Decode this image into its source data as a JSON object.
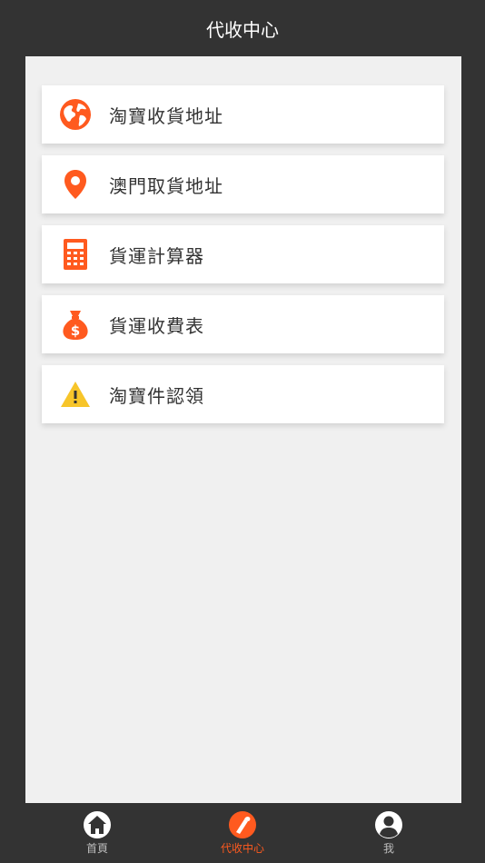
{
  "header": {
    "title": "代收中心"
  },
  "menu": [
    {
      "label": "淘寶收貨地址",
      "icon": "globe-icon"
    },
    {
      "label": "澳門取貨地址",
      "icon": "location-pin-icon"
    },
    {
      "label": "貨運計算器",
      "icon": "calculator-icon"
    },
    {
      "label": "貨運收費表",
      "icon": "money-bag-icon"
    },
    {
      "label": "淘寶件認領",
      "icon": "warning-icon"
    }
  ],
  "tabbar": {
    "tabs": [
      {
        "label": "首頁",
        "icon": "home-icon",
        "active": false
      },
      {
        "label": "代收中心",
        "icon": "collection-center-icon",
        "active": true
      },
      {
        "label": "我",
        "icon": "user-icon",
        "active": false
      }
    ]
  },
  "colors": {
    "accent": "#ff5a1f",
    "background": "#333333",
    "content": "#f0f0f0",
    "warning": "#f7c52a"
  }
}
